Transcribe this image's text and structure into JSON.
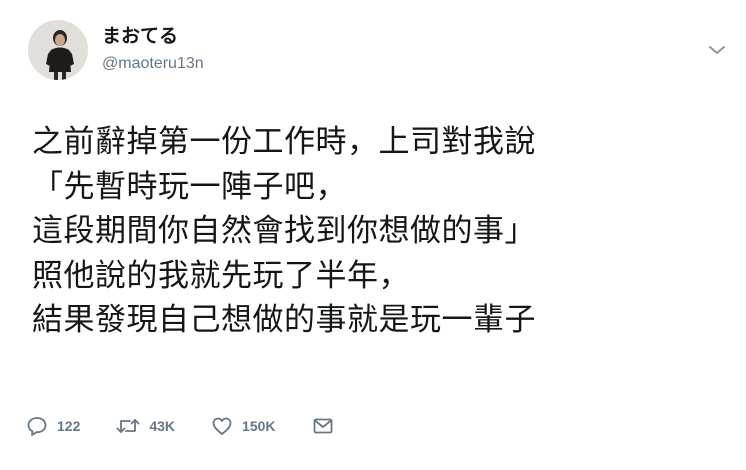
{
  "user": {
    "display_name": "まおてる",
    "handle": "@maoteru13n"
  },
  "tweet": {
    "lines": [
      "之前辭掉第一份工作時，上司對我說",
      "「先暫時玩一陣子吧，",
      "這段期間你自然會找到你想做的事」",
      "照他說的我就先玩了半年，",
      "結果發現自己想做的事就是玩一輩子"
    ]
  },
  "actions": {
    "reply_count": "122",
    "retweet_count": "43K",
    "like_count": "150K"
  },
  "icons": {
    "reply": "reply-icon",
    "retweet": "retweet-icon",
    "like": "heart-icon",
    "dm": "envelope-icon",
    "menu": "chevron-down-icon"
  },
  "colors": {
    "text": "#14171a",
    "secondary": "#657786",
    "background": "#ffffff"
  }
}
